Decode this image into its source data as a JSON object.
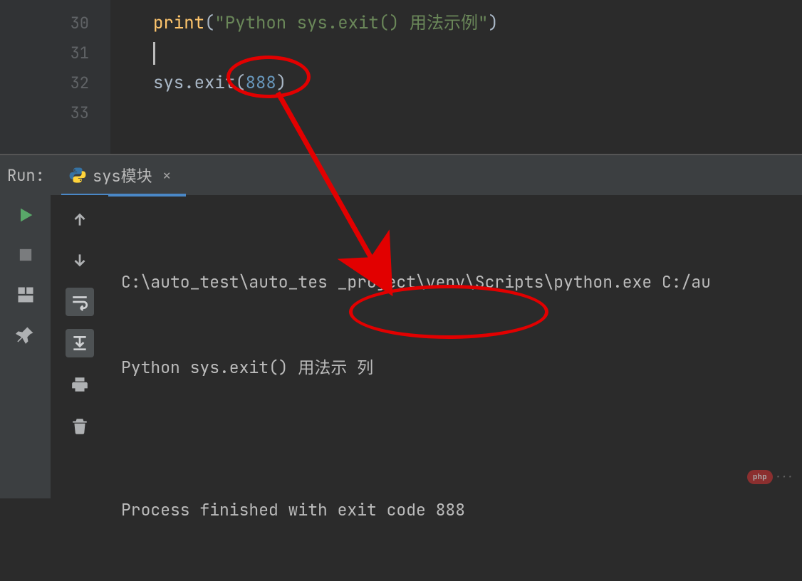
{
  "editor": {
    "lines": [
      {
        "num": "30",
        "segments": [
          {
            "cls": "t-fn",
            "text": "print"
          },
          {
            "cls": "t-plain",
            "text": "("
          },
          {
            "cls": "t-str",
            "text": "\"Python sys.exit() 用法示例\""
          },
          {
            "cls": "t-plain",
            "text": ")"
          }
        ]
      },
      {
        "num": "31",
        "caret": true,
        "segments": []
      },
      {
        "num": "32",
        "segments": [
          {
            "cls": "t-plain",
            "text": "sys.exit("
          },
          {
            "cls": "t-num",
            "text": "888"
          },
          {
            "cls": "t-plain",
            "text": ")"
          }
        ]
      },
      {
        "num": "33",
        "segments": []
      }
    ]
  },
  "run": {
    "label": "Run:",
    "tab": {
      "name": "sys模块",
      "close": "×"
    }
  },
  "console": {
    "line1": "C:\\auto_test\\auto_tes _project\\venv\\Scripts\\python.exe C:/au",
    "line2": "Python sys.exit() 用法示 列",
    "line3": "",
    "line4": "Process finished with exit code 888"
  },
  "watermark": {
    "badge": "php",
    "text": "···"
  }
}
